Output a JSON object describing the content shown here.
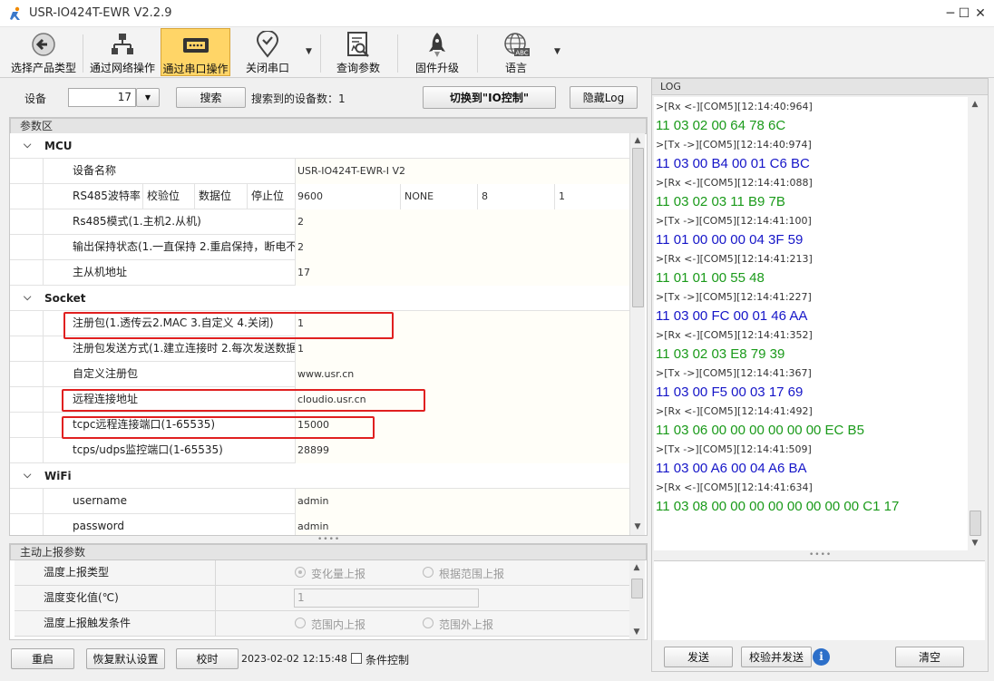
{
  "window": {
    "title": "USR-IO424T-EWR V2.2.9",
    "minimize": "─",
    "maximize": "☐",
    "close": "✕"
  },
  "toolbar": {
    "items": [
      {
        "label": "选择产品类型"
      },
      {
        "label": "通过网络操作"
      },
      {
        "label": "通过串口操作"
      },
      {
        "label": "关闭串口"
      },
      {
        "label": "查询参数"
      },
      {
        "label": "固件升级"
      },
      {
        "label": "语言"
      }
    ],
    "dropdown": "▼"
  },
  "device_bar": {
    "device_label": "设备",
    "device_value": "17",
    "search_button": "搜索",
    "found_text": "搜索到的设备数：1",
    "switch_button": "切换到\"IO控制\"",
    "hide_log_button": "隐藏Log"
  },
  "params": {
    "title": "参数区",
    "mcu": {
      "title": "MCU",
      "device_name_label": "设备名称",
      "device_name_value": "USR-IO424T-EWR-I V2",
      "rs485_labels": [
        "RS485波特率",
        "校验位",
        "数据位",
        "停止位"
      ],
      "rs485_values": [
        "9600",
        "NONE",
        "8",
        "1"
      ],
      "rs485_mode_label": "Rs485模式(1.主机2.从机)",
      "rs485_mode_value": "2",
      "output_hold_label": "输出保持状态(1.一直保持 2.重启保持，断电不",
      "output_hold_value": "2",
      "slave_addr_label": "主从机地址",
      "slave_addr_value": "17"
    },
    "socket": {
      "title": "Socket",
      "reg_pkg_label": "注册包(1.透传云2.MAC 3.自定义 4.关闭)",
      "reg_pkg_value": "1",
      "reg_send_label": "注册包发送方式(1.建立连接时 2.每次发送数据",
      "reg_send_value": "1",
      "custom_reg_label": "自定义注册包",
      "custom_reg_value": "www.usr.cn",
      "remote_addr_label": "远程连接地址",
      "remote_addr_value": "cloudio.usr.cn",
      "remote_port_label": "tcpc远程连接端口(1-65535)",
      "remote_port_value": "15000",
      "monitor_port_label": "tcps/udps监控端口(1-65535)",
      "monitor_port_value": "28899"
    },
    "wifi": {
      "title": "WiFi",
      "username_label": "username",
      "username_value": "admin",
      "password_label": "password",
      "password_value": "admin"
    }
  },
  "report": {
    "title": "主动上报参数",
    "type_label": "温度上报类型",
    "type_opt1": "变化量上报",
    "type_opt2": "根据范围上报",
    "change_label": "温度变化值(℃)",
    "change_value": "1",
    "trigger_label": "温度上报触发条件",
    "trigger_opt1": "范围内上报",
    "trigger_opt2": "范围外上报"
  },
  "bottom": {
    "restart": "重启",
    "restore": "恢复默认设置",
    "timing": "校时",
    "datetime": "2023-02-02 12:15:48 4",
    "condition": "条件控制"
  },
  "log": {
    "title": "LOG",
    "lines": [
      {
        "meta": ">[Rx <-][COM5][12:14:40:964]",
        "hex": "11 03 02 00 64 78 6C",
        "dir": "rx"
      },
      {
        "meta": ">[Tx ->][COM5][12:14:40:974]",
        "hex": "11 03 00 B4 00 01 C6 BC",
        "dir": "tx"
      },
      {
        "meta": ">[Rx <-][COM5][12:14:41:088]",
        "hex": "11 03 02 03 11 B9 7B",
        "dir": "rx"
      },
      {
        "meta": ">[Tx ->][COM5][12:14:41:100]",
        "hex": "11 01 00 00 00 04 3F 59",
        "dir": "tx"
      },
      {
        "meta": ">[Rx <-][COM5][12:14:41:213]",
        "hex": "11 01 01 00 55 48",
        "dir": "rx"
      },
      {
        "meta": ">[Tx ->][COM5][12:14:41:227]",
        "hex": "11 03 00 FC 00 01 46 AA",
        "dir": "tx"
      },
      {
        "meta": ">[Rx <-][COM5][12:14:41:352]",
        "hex": "11 03 02 03 E8 79 39",
        "dir": "rx"
      },
      {
        "meta": ">[Tx ->][COM5][12:14:41:367]",
        "hex": "11 03 00 F5 00 03 17 69",
        "dir": "tx"
      },
      {
        "meta": ">[Rx <-][COM5][12:14:41:492]",
        "hex": "11 03 06 00 00 00 00 00 00 EC B5",
        "dir": "rx"
      },
      {
        "meta": ">[Tx ->][COM5][12:14:41:509]",
        "hex": "11 03 00 A6 00 04 A6 BA",
        "dir": "tx"
      },
      {
        "meta": ">[Rx <-][COM5][12:14:41:634]",
        "hex": "11 03 08 00 00 00 00 00 00 00 00 C1 17",
        "dir": "rx"
      }
    ],
    "send": "发送",
    "check_send": "校验并发送",
    "clear": "清空",
    "info": "i"
  },
  "colors": {
    "rx": "#1a9a1a",
    "tx": "#1515c8",
    "highlight": "#e02020",
    "active_tab": "#ffd567"
  }
}
